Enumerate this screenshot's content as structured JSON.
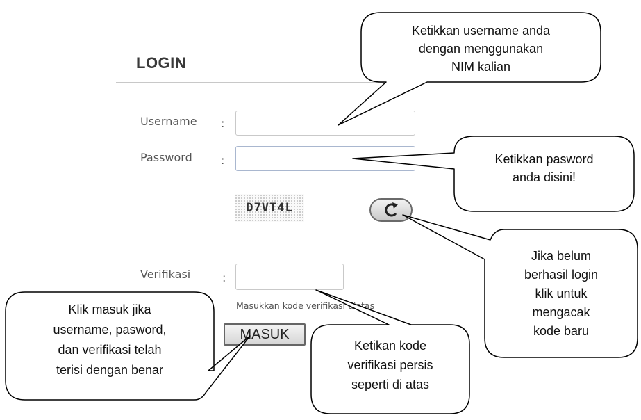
{
  "login": {
    "title": "LOGIN",
    "username_label": "Username",
    "password_label": "Password",
    "verifikasi_label": "Verifikasi",
    "colon": ":",
    "username_value": "",
    "password_value": "",
    "verifikasi_value": "",
    "captcha_code": "D7VT4L",
    "refresh_icon": "refresh-icon",
    "verif_hint": "Masukkan kode verifikasi diatas",
    "submit_label": "MASUK"
  },
  "callouts": {
    "username": [
      "Ketikkan username anda",
      "dengan menggunakan",
      "NIM kalian"
    ],
    "password": [
      "Ketikkan pasword",
      "anda disini!"
    ],
    "refresh": [
      "Jika belum",
      "berhasil login",
      "klik untuk",
      "mengacak",
      "kode baru"
    ],
    "verifikasi": [
      "Ketikan kode",
      "verifikasi persis",
      "seperti di atas"
    ],
    "masuk": [
      "Klik masuk jika",
      "username, pasword,",
      "dan verifikasi telah",
      "terisi dengan benar"
    ]
  }
}
